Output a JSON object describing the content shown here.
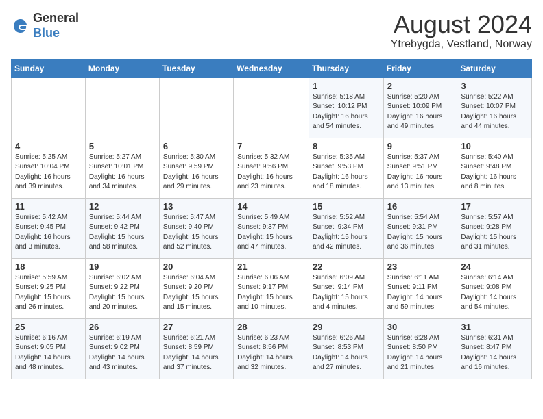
{
  "header": {
    "logo_general": "General",
    "logo_blue": "Blue",
    "month_year": "August 2024",
    "location": "Ytrebygda, Vestland, Norway"
  },
  "weekdays": [
    "Sunday",
    "Monday",
    "Tuesday",
    "Wednesday",
    "Thursday",
    "Friday",
    "Saturday"
  ],
  "weeks": [
    [
      {
        "day": "",
        "info": ""
      },
      {
        "day": "",
        "info": ""
      },
      {
        "day": "",
        "info": ""
      },
      {
        "day": "",
        "info": ""
      },
      {
        "day": "1",
        "info": "Sunrise: 5:18 AM\nSunset: 10:12 PM\nDaylight: 16 hours\nand 54 minutes."
      },
      {
        "day": "2",
        "info": "Sunrise: 5:20 AM\nSunset: 10:09 PM\nDaylight: 16 hours\nand 49 minutes."
      },
      {
        "day": "3",
        "info": "Sunrise: 5:22 AM\nSunset: 10:07 PM\nDaylight: 16 hours\nand 44 minutes."
      }
    ],
    [
      {
        "day": "4",
        "info": "Sunrise: 5:25 AM\nSunset: 10:04 PM\nDaylight: 16 hours\nand 39 minutes."
      },
      {
        "day": "5",
        "info": "Sunrise: 5:27 AM\nSunset: 10:01 PM\nDaylight: 16 hours\nand 34 minutes."
      },
      {
        "day": "6",
        "info": "Sunrise: 5:30 AM\nSunset: 9:59 PM\nDaylight: 16 hours\nand 29 minutes."
      },
      {
        "day": "7",
        "info": "Sunrise: 5:32 AM\nSunset: 9:56 PM\nDaylight: 16 hours\nand 23 minutes."
      },
      {
        "day": "8",
        "info": "Sunrise: 5:35 AM\nSunset: 9:53 PM\nDaylight: 16 hours\nand 18 minutes."
      },
      {
        "day": "9",
        "info": "Sunrise: 5:37 AM\nSunset: 9:51 PM\nDaylight: 16 hours\nand 13 minutes."
      },
      {
        "day": "10",
        "info": "Sunrise: 5:40 AM\nSunset: 9:48 PM\nDaylight: 16 hours\nand 8 minutes."
      }
    ],
    [
      {
        "day": "11",
        "info": "Sunrise: 5:42 AM\nSunset: 9:45 PM\nDaylight: 16 hours\nand 3 minutes."
      },
      {
        "day": "12",
        "info": "Sunrise: 5:44 AM\nSunset: 9:42 PM\nDaylight: 15 hours\nand 58 minutes."
      },
      {
        "day": "13",
        "info": "Sunrise: 5:47 AM\nSunset: 9:40 PM\nDaylight: 15 hours\nand 52 minutes."
      },
      {
        "day": "14",
        "info": "Sunrise: 5:49 AM\nSunset: 9:37 PM\nDaylight: 15 hours\nand 47 minutes."
      },
      {
        "day": "15",
        "info": "Sunrise: 5:52 AM\nSunset: 9:34 PM\nDaylight: 15 hours\nand 42 minutes."
      },
      {
        "day": "16",
        "info": "Sunrise: 5:54 AM\nSunset: 9:31 PM\nDaylight: 15 hours\nand 36 minutes."
      },
      {
        "day": "17",
        "info": "Sunrise: 5:57 AM\nSunset: 9:28 PM\nDaylight: 15 hours\nand 31 minutes."
      }
    ],
    [
      {
        "day": "18",
        "info": "Sunrise: 5:59 AM\nSunset: 9:25 PM\nDaylight: 15 hours\nand 26 minutes."
      },
      {
        "day": "19",
        "info": "Sunrise: 6:02 AM\nSunset: 9:22 PM\nDaylight: 15 hours\nand 20 minutes."
      },
      {
        "day": "20",
        "info": "Sunrise: 6:04 AM\nSunset: 9:20 PM\nDaylight: 15 hours\nand 15 minutes."
      },
      {
        "day": "21",
        "info": "Sunrise: 6:06 AM\nSunset: 9:17 PM\nDaylight: 15 hours\nand 10 minutes."
      },
      {
        "day": "22",
        "info": "Sunrise: 6:09 AM\nSunset: 9:14 PM\nDaylight: 15 hours\nand 4 minutes."
      },
      {
        "day": "23",
        "info": "Sunrise: 6:11 AM\nSunset: 9:11 PM\nDaylight: 14 hours\nand 59 minutes."
      },
      {
        "day": "24",
        "info": "Sunrise: 6:14 AM\nSunset: 9:08 PM\nDaylight: 14 hours\nand 54 minutes."
      }
    ],
    [
      {
        "day": "25",
        "info": "Sunrise: 6:16 AM\nSunset: 9:05 PM\nDaylight: 14 hours\nand 48 minutes."
      },
      {
        "day": "26",
        "info": "Sunrise: 6:19 AM\nSunset: 9:02 PM\nDaylight: 14 hours\nand 43 minutes."
      },
      {
        "day": "27",
        "info": "Sunrise: 6:21 AM\nSunset: 8:59 PM\nDaylight: 14 hours\nand 37 minutes."
      },
      {
        "day": "28",
        "info": "Sunrise: 6:23 AM\nSunset: 8:56 PM\nDaylight: 14 hours\nand 32 minutes."
      },
      {
        "day": "29",
        "info": "Sunrise: 6:26 AM\nSunset: 8:53 PM\nDaylight: 14 hours\nand 27 minutes."
      },
      {
        "day": "30",
        "info": "Sunrise: 6:28 AM\nSunset: 8:50 PM\nDaylight: 14 hours\nand 21 minutes."
      },
      {
        "day": "31",
        "info": "Sunrise: 6:31 AM\nSunset: 8:47 PM\nDaylight: 14 hours\nand 16 minutes."
      }
    ]
  ]
}
